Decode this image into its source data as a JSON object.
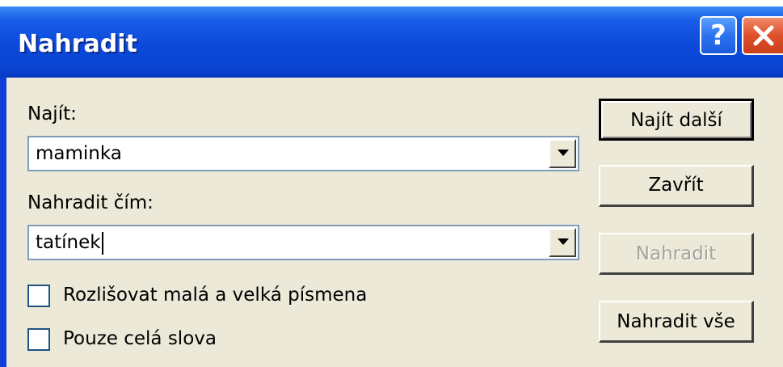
{
  "window": {
    "title": "Nahradit",
    "help_glyph": "?",
    "close_icon": "close-icon"
  },
  "find": {
    "label": "Najít:",
    "value": "maminka"
  },
  "replace": {
    "label": "Nahradit čím:",
    "value": "tatínek"
  },
  "options": {
    "match_case": {
      "label": "Rozlišovat malá a velká písmena",
      "checked": false
    },
    "whole_words": {
      "label": "Pouze celá slova",
      "checked": false
    }
  },
  "buttons": {
    "find_next": "Najít další",
    "close": "Zavřít",
    "replace": "Nahradit",
    "replace_all": "Nahradit vše"
  },
  "colors": {
    "titlebar": "#0b49da",
    "client": "#ece9d8",
    "close_button": "#e0502a",
    "help_button": "#2d72f0",
    "disabled_text": "#a6a39a"
  }
}
